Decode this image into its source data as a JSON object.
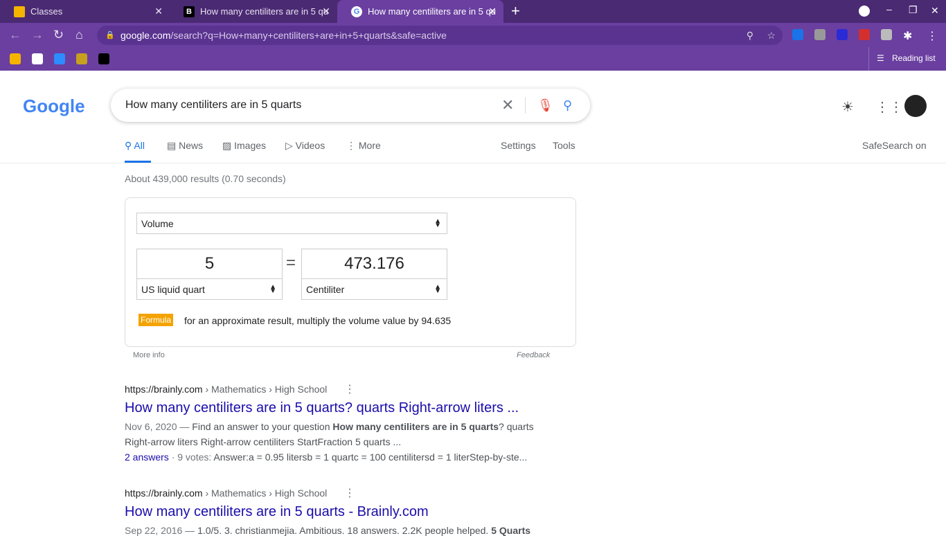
{
  "browser": {
    "tabs": [
      {
        "title": "Classes"
      },
      {
        "title": "How many centiliters are in 5 qu"
      },
      {
        "title": "How many centiliters are in 5 qu"
      }
    ],
    "url_host": "google.com",
    "url_path": "/search?q=How+many+centiliters+are+in+5+quarts&safe=active",
    "reading_list": "Reading list"
  },
  "google": {
    "logo": "Google",
    "query": "How many centiliters are in 5 quarts",
    "tabs": [
      "All",
      "News",
      "Images",
      "Videos",
      "More"
    ],
    "settings": "Settings",
    "tools": "Tools",
    "safesearch": "SafeSearch on",
    "stats": "About 439,000 results (0.70 seconds)"
  },
  "converter": {
    "category": "Volume",
    "from_value": "5",
    "equals": "=",
    "to_value": "473.176",
    "from_unit": "US liquid quart",
    "to_unit": "Centiliter",
    "formula_badge": "Formula",
    "formula_text": "for an approximate result, multiply the volume value by 94.635",
    "more_info": "More info",
    "feedback": "Feedback"
  },
  "results": [
    {
      "site": "https://brainly.com",
      "crumbs": " › Mathematics › High School",
      "title": "How many centiliters are in 5 quarts? quarts Right-arrow liters ...",
      "date": "Nov 6, 2020 — ",
      "pre": "Find an answer to your question ",
      "bold": "How many centiliters are in 5 quarts",
      "post": "? quarts",
      "line2": "Right-arrow liters Right-arrow centiliters StartFraction 5 quarts ...",
      "answers": "2 answers",
      "votes": " · 9 votes: ",
      "answer": "Answer:a = 0.95 litersb = 1 quartc = 100 centilitersd = 1 literStep-by-ste..."
    },
    {
      "site": "https://brainly.com",
      "crumbs": " › Mathematics › High School",
      "title": "How many centiliters are in 5 quarts - Brainly.com",
      "date": "Sep 22, 2016 — ",
      "pre": "1.0/5. 3. christianmejia. Ambitious. 18 answers. 2.2K people helped. ",
      "bold": "5 Quarts"
    }
  ]
}
